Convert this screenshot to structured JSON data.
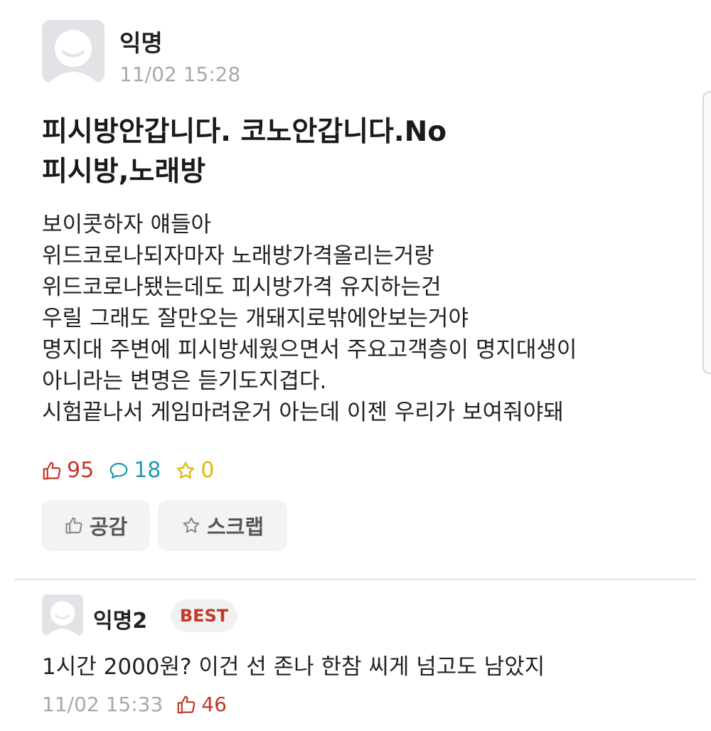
{
  "post": {
    "author": "익명",
    "time": "11/02 15:28",
    "title_lines": [
      "피시방안갑니다. 코노안갑니다.No",
      "피시방,노래방"
    ],
    "body_lines": [
      "보이콧하자 얘들아",
      "위드코로나되자마자 노래방가격올리는거랑",
      "위드코로나됐는데도 피시방가격 유지하는건",
      "우릴 그래도 잘만오는 개돼지로밖에안보는거야",
      "명지대 주변에 피시방세웠으면서 주요고객층이 명지대생이",
      "아니라는 변명은 듣기도지겹다.",
      "시험끝나서 게임마려운거 아는데 이젠 우리가 보여줘야돼"
    ],
    "stats": {
      "likes": "95",
      "comments": "18",
      "scraps": "0"
    },
    "buttons": {
      "like_label": "공감",
      "scrap_label": "스크랩"
    }
  },
  "comment": {
    "author": "익명2",
    "badge": "BEST",
    "text": "1시간 2000원? 이건 선 존나 한참 씨게 넘고도 남았지",
    "time": "11/02 15:33",
    "likes": "46"
  },
  "icons": {
    "like": "thumbs-up-icon",
    "comment": "speech-bubble-icon",
    "scrap": "star-icon",
    "avatar": "default-avatar-icon"
  },
  "colors": {
    "like": "#c0392b",
    "comment": "#1f9bb0",
    "scrap": "#e2b600",
    "muted": "#a8a8a8",
    "best_badge": "#c0392b"
  }
}
